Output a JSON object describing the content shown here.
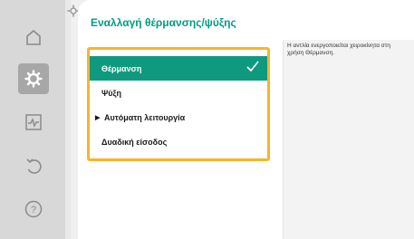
{
  "page": {
    "title": "Εναλλαγή θέρμανσης/ψύξης"
  },
  "sidebar": {
    "items": [
      {
        "icon": "home-icon",
        "active": false
      },
      {
        "icon": "settings-gear-icon",
        "active": true
      },
      {
        "icon": "diagnostics-monitor-icon",
        "active": false
      },
      {
        "icon": "undo-icon",
        "active": false
      },
      {
        "icon": "help-icon",
        "active": false
      }
    ]
  },
  "menu": {
    "items": [
      {
        "label": "Θέρμανση",
        "selected": true
      },
      {
        "label": "Ψύξη",
        "selected": false
      },
      {
        "label": "Αυτόματη λειτουργία",
        "selected": false,
        "has_arrow": true
      },
      {
        "label": "Δυαδική είσοδος",
        "selected": false
      }
    ]
  },
  "info": {
    "text": "Η αντλία ενεργοποιείται χειροκίνητα στη χρήση Θέρμανση."
  },
  "colors": {
    "accent": "#009c82",
    "selected_bg": "#0f9a80",
    "focus_border": "#f7b52b",
    "sidebar_bg": "#d8d8d8"
  }
}
